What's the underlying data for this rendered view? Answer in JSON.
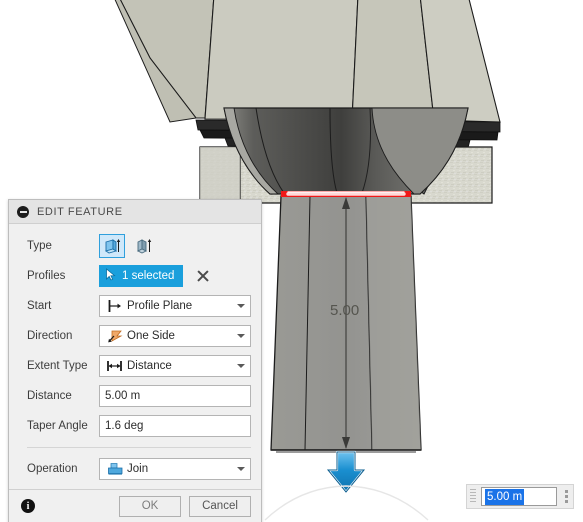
{
  "app": {
    "name": "cad-modeler",
    "viewport_background": "#ffffff"
  },
  "panel": {
    "title": "EDIT FEATURE",
    "collapse_icon": "collapse-minus-icon",
    "rows": {
      "type": {
        "label": "Type",
        "options": [
          {
            "name": "extrude-profile-icon",
            "selected": true
          },
          {
            "name": "extrude-surface-icon",
            "selected": false
          }
        ]
      },
      "profiles": {
        "label": "Profiles",
        "chip_text": "1 selected",
        "chip_icon": "cursor-arrow-icon",
        "clear_icon": "clear-x-icon"
      },
      "start": {
        "label": "Start",
        "value": "Profile Plane",
        "icon": "profile-plane-icon"
      },
      "direction": {
        "label": "Direction",
        "value": "One Side",
        "icon": "one-side-arrow-icon"
      },
      "extent_type": {
        "label": "Extent Type",
        "value": "Distance",
        "icon": "distance-measure-icon"
      },
      "distance": {
        "label": "Distance",
        "value": "5.00 m"
      },
      "taper_angle": {
        "label": "Taper Angle",
        "value": "1.6 deg"
      },
      "operation": {
        "label": "Operation",
        "value": "Join",
        "icon": "join-boolean-icon"
      }
    },
    "footer": {
      "info_icon": "info-icon",
      "info_glyph": "i",
      "ok_label": "OK",
      "cancel_label": "Cancel"
    }
  },
  "inline_dim_input": {
    "value": "5.00 m",
    "selected": true,
    "grip_icon": "drag-grip-icon",
    "menu_icon": "kebab-menu-icon"
  },
  "viewport": {
    "dimension_label": "5.00",
    "manipulator_arrow": "extrude-drag-arrow-down-icon",
    "highlight_color": "#f01818",
    "accent_color": "#1a9fdc",
    "colors": {
      "top_shell_light": "#c9c9bd",
      "top_shell_mid": "#bdbdb1",
      "concrete_band": "#d6d6cc",
      "funnel_dark": "#4b4b49",
      "funnel_mid": "#6e6e6b",
      "funnel_light": "#9a9a95",
      "extrude_body": "#959590",
      "edge_line": "#1c1c1c"
    }
  }
}
